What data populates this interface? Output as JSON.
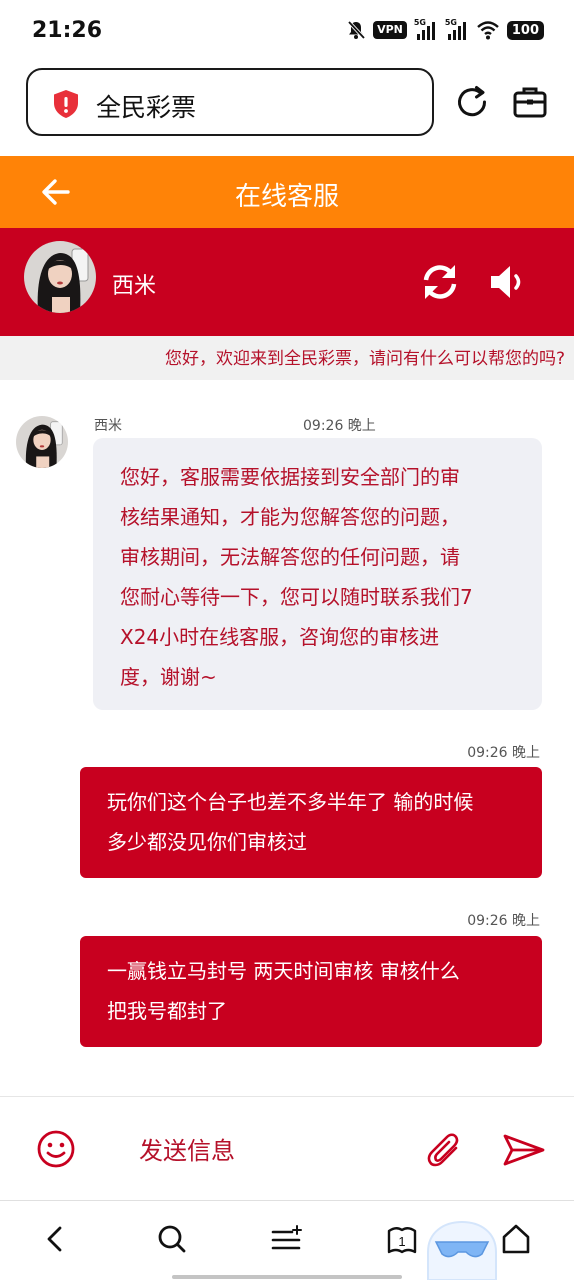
{
  "status_bar": {
    "time": "21:26",
    "vpn_label": "VPN",
    "network_1": "5G",
    "network_2": "5G",
    "battery": "100",
    "icons": [
      "mute-icon",
      "vpn-icon",
      "signal-icon",
      "signal-icon",
      "wifi-icon",
      "battery-icon"
    ]
  },
  "browser": {
    "url_text": "全民彩票",
    "icons": [
      "shield-warning-icon",
      "reload-icon",
      "briefcase-icon"
    ]
  },
  "header": {
    "title": "在线客服",
    "back_icon": "back-arrow-icon",
    "background": "#FF8307"
  },
  "agent": {
    "name": "西米",
    "icons": [
      "refresh-icon",
      "speaker-icon"
    ],
    "background": "#C8001F"
  },
  "marquee": {
    "text": "您好，欢迎来到全民彩票，请问有什么可以帮您的吗?"
  },
  "messages": [
    {
      "direction": "incoming",
      "sender": "西米",
      "time": "09:26 晚上",
      "lines": [
        "您好，客服需要依据接到安全部门的审",
        "核结果通知，才能为您解答您的问题，",
        "审核期间，无法解答您的任何问题，请",
        "您耐心等待一下，您可以随时联系我们7",
        "X24小时在线客服，咨询您的审核进",
        "度，谢谢~"
      ]
    },
    {
      "direction": "outgoing",
      "time": "09:26 晚上",
      "lines": [
        "玩你们这个台子也差不多半年了 输的时候",
        "多少都没见你们审核过"
      ]
    },
    {
      "direction": "outgoing",
      "time": "09:26 晚上",
      "lines": [
        "一赢钱立马封号 两天时间审核 审核什么",
        "把我号都封了"
      ]
    }
  ],
  "composer": {
    "placeholder": "发送信息",
    "icons": [
      "emoji-icon",
      "attach-icon",
      "send-icon"
    ]
  },
  "nav": {
    "tab_count": "1",
    "icons": [
      "back-icon",
      "search-icon",
      "menu-icon",
      "tabs-icon",
      "home-icon"
    ]
  },
  "colors": {
    "accent_orange": "#FF8307",
    "accent_red": "#C8001F",
    "text_red": "#B5112A"
  }
}
